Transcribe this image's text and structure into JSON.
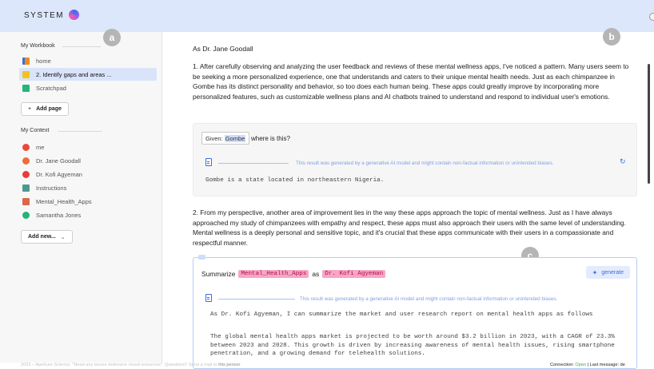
{
  "brand": {
    "name": "SYSTEM"
  },
  "badges": {
    "a": "a",
    "b": "b",
    "c": "c"
  },
  "sidebar": {
    "workbook_title": "My Workbook",
    "workbook_items": [
      {
        "label": "home",
        "color": "#f08a1c"
      },
      {
        "label": "2. Identify gaps and areas ...",
        "color": "#f4c21b"
      },
      {
        "label": "Scratchpad",
        "color": "#23b57b"
      }
    ],
    "add_page": "Add page",
    "context_title": "My Context",
    "context_items": [
      {
        "label": "me",
        "color": "#e94a3a"
      },
      {
        "label": "Dr. Jane Goodall",
        "color": "#f06b3a"
      },
      {
        "label": "Dr. Kofi Agyeman",
        "color": "#e93b3b"
      },
      {
        "label": "Instructions",
        "color": "#4a9b8d"
      },
      {
        "label": "Mental_Health_Apps",
        "color": "#d9684a"
      },
      {
        "label": "Samantha Jones",
        "color": "#22b573"
      }
    ],
    "add_new": "Add new..."
  },
  "main": {
    "heading": "As Dr. Jane Goodall",
    "para1": "1. After carefully observing and analyzing the user feedback and reviews of these mental wellness apps, I've noticed a pattern. Many users seem to be seeking a more personalized experience, one that understands and caters to their unique mental health needs. Just as each chimpanzee in Gombe has its distinct personality and behavior, so too does each human being. These apps could greatly improve by incorporating more personalized features, such as customizable wellness plans and AI chatbots trained to understand and respond to individual user's emotions.",
    "card1": {
      "given_label": "Given:",
      "given_value": "Gombe",
      "question": "where is this?",
      "disclaimer": "This result was generated by a generative AI model and might contain non-factual information or unintended biases.",
      "answer": "Gombe is a state located in northeastern Nigeria."
    },
    "para2": "2. From my perspective, another area of improvement lies in the way these apps approach the topic of mental wellness. Just as I have always approached my study of chimpanzees with empathy and respect, these apps must also approach their users with the same level of understanding. Mental wellness is a deeply personal and sensitive topic, and it's crucial that these apps communicate with their users in a compassionate and respectful manner.",
    "card2": {
      "summarize": "Summarize",
      "chip1": "Mental_Health_Apps",
      "as": "as",
      "chip2": "Dr. Kofi Agyeman",
      "generate": "generate",
      "disclaimer": "This result was generated by a generative AI model and might contain non-factual information or unintended biases.",
      "out1": "As Dr. Kofi Agyeman, I can summarize the market and user research report on mental health apps as follows",
      "out2": "The global mental health apps market is projected to be worth around $3.2 billion in 2023, with a CAGR of 23.3% between 2023 and 2028. This growth is driven by increasing awareness of mental health issues, rising smartphone penetration, and a growing demand for telehealth solutions."
    }
  },
  "footer": {
    "left": "2023 – Aperture Science. \"Need any tenure defensive mood resources\". Questions? Send a mail to",
    "left_link": "this person",
    "connection_label": "Connection:",
    "connection_status": "Open",
    "last_message": "| Last message: de"
  }
}
